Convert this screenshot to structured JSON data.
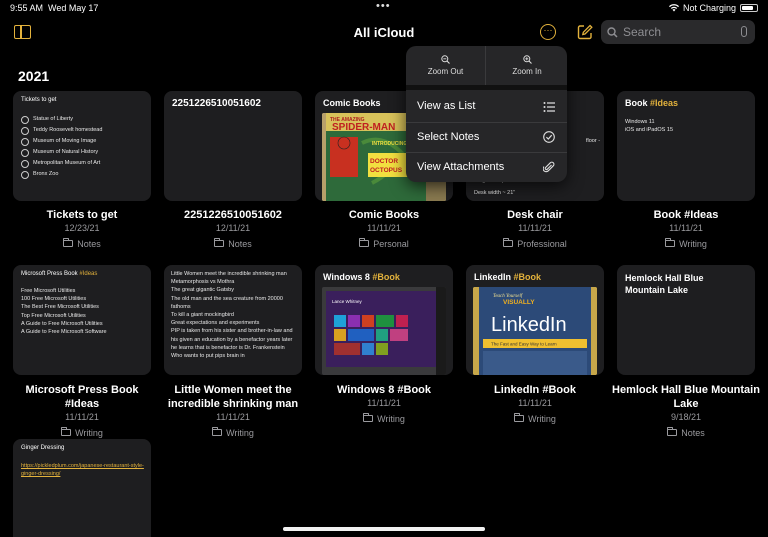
{
  "status_bar": {
    "time": "9:55 AM",
    "date": "Wed May 17",
    "charging": "Not Charging"
  },
  "nav": {
    "title": "All iCloud",
    "search_placeholder": "Search"
  },
  "section": {
    "year": "2021"
  },
  "menu": {
    "zoom_out": "Zoom Out",
    "zoom_in": "Zoom In",
    "view_as_list": "View as List",
    "select_notes": "Select Notes",
    "view_attachments": "View Attachments"
  },
  "notes": [
    {
      "card_title": "Tickets to get",
      "checklist": [
        "Statue of Liberty",
        "Teddy Roosevelt homestead",
        "Museum of Moving Image",
        "Museum of Natural History",
        "Metropolitan Museum of Art",
        "Bronx Zoo"
      ],
      "title": "Tickets to get",
      "date": "12/23/21",
      "folder": "Notes"
    },
    {
      "card_title": "2251226510051602",
      "title": "2251226510051602",
      "date": "12/11/21",
      "folder": "Notes"
    },
    {
      "card_title": "Comic Books",
      "photo": "comic-cover",
      "title": "Comic Books",
      "date": "11/11/21",
      "folder": "Personal"
    },
    {
      "card_body": [
        "Height to top of arms ~ 25",
        "",
        "Desk width ~ 21\""
      ],
      "card_side_text": "floor -",
      "title": "Desk chair",
      "date": "11/11/21",
      "folder": "Professional"
    },
    {
      "card_title": "Book ",
      "card_tag": "#Ideas",
      "card_body": [
        "Windows 11",
        "iOS and iPadOS 15"
      ],
      "title": "Book #Ideas",
      "date": "11/11/21",
      "folder": "Writing"
    },
    {
      "card_title": "Microsoft Press Book ",
      "card_tag": "#Ideas",
      "card_body": [
        "",
        "Free Microsoft Utilities",
        "100 Free Microsoft Utilities",
        "The Best Free Microsoft Utilities",
        "Top Free Microsoft Utilities",
        "A Guide to Free Microsoft Utilities",
        "A Guide to Free Microsoft Software"
      ],
      "title": "Microsoft Press Book #Ideas",
      "date": "11/11/21",
      "folder": "Writing"
    },
    {
      "card_body": [
        "Little Women meet the incredible shrinking man",
        "Metamorphosis vs Mothra",
        "The great gigantic Gatsby",
        "The old man and the sea creature from 20000 fathoms",
        "To kill a giant mockingbird",
        "Great expectations and experiments",
        "PIP is taken from his sister and brother-in-law and his given an education by a benefactor years later he learns that is benefactor is Dr. Frankenstein Who wants to put pips brain in"
      ],
      "title": "Little Women meet the incredible shrinking man",
      "date": "11/11/21",
      "folder": "Writing"
    },
    {
      "card_title": "Windows 8 ",
      "card_tag": "#Book",
      "photo": "windows-tablet",
      "photo_caption": "Lance Whitney",
      "title": "Windows 8 #Book",
      "date": "11/11/21",
      "folder": "Writing"
    },
    {
      "card_title": "LinkedIn ",
      "card_tag": "#Book",
      "photo": "linkedin-book",
      "book_top": "Teach Yourself VISUALLY",
      "book_word": "LinkedIn",
      "book_sub": "The Fast and Easy Way to Learn",
      "title": "LinkedIn #Book",
      "date": "11/11/21",
      "folder": "Writing"
    },
    {
      "card_title": "Hemlock Hall Blue Mountain Lake",
      "title": "Hemlock Hall Blue Mountain Lake",
      "date": "9/18/21",
      "folder": "Notes"
    },
    {
      "card_title": "Ginger Dressing",
      "card_link": "https://pickledplum.com/japanese-restaurant-style-ginger-dressing/"
    }
  ],
  "comic": {
    "top": "THE AMAZING",
    "name": "SPIDER-MAN",
    "villain": "DOCTOR OCTOPUS",
    "intro": "INTRODUCING"
  },
  "colors": {
    "accent": "#e3b23c",
    "card": "#1e1e20",
    "background": "#000000"
  }
}
